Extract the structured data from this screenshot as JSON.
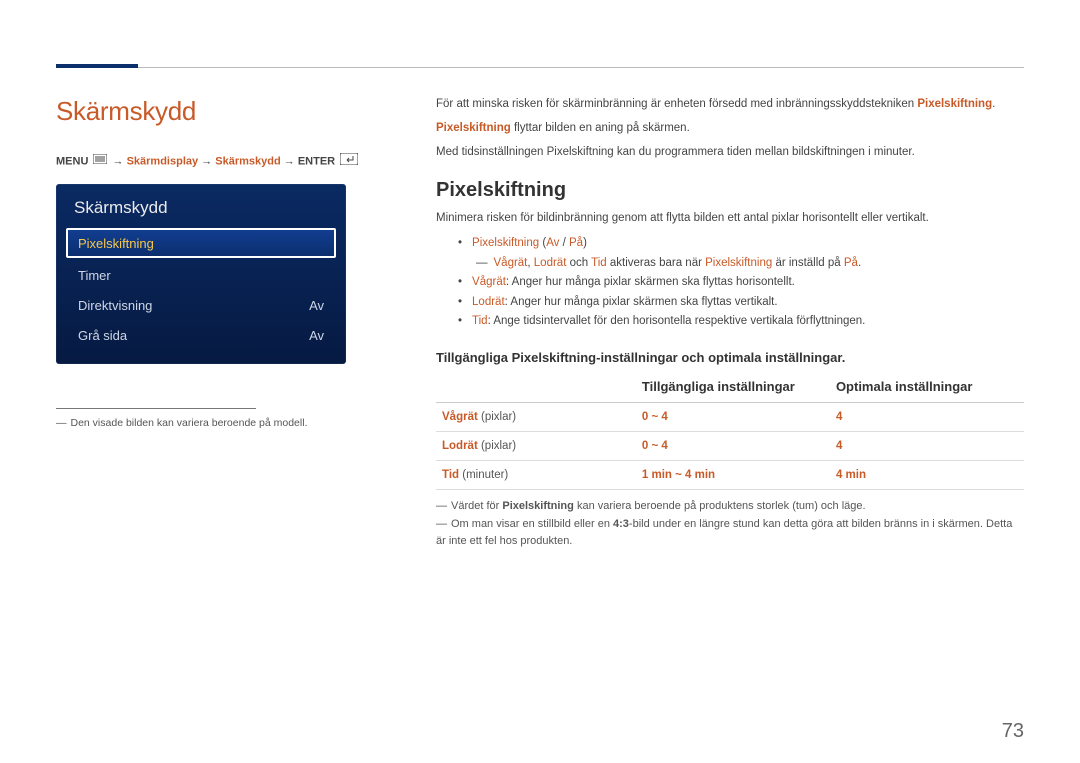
{
  "page_number": "73",
  "left": {
    "title": "Skärmskydd",
    "breadcrumb": {
      "menu_label": "MENU",
      "arrow": " → ",
      "seg1": "Skärmdisplay",
      "seg2": "Skärmskydd",
      "enter_label": "ENTER"
    },
    "panel": {
      "title": "Skärmskydd",
      "items": [
        {
          "label": "Pixelskiftning",
          "value": "",
          "selected": true
        },
        {
          "label": "Timer",
          "value": "",
          "selected": false
        },
        {
          "label": "Direktvisning",
          "value": "Av",
          "selected": false
        },
        {
          "label": "Grå sida",
          "value": "Av",
          "selected": false
        }
      ]
    },
    "disclaimer": "Den visade bilden kan variera beroende på modell."
  },
  "right": {
    "intro_parts": {
      "p1a": "För att minska risken för skärminbränning är enheten försedd med inbränningsskyddstekniken ",
      "p1b": "Pixelskiftning",
      "p1c": ".",
      "p2a": "Pixelskiftning",
      "p2b": " flyttar bilden en aning på skärmen.",
      "p3": "Med tidsinställningen Pixelskiftning kan du programmera tiden mellan bildskiftningen i minuter."
    },
    "section_title": "Pixelskiftning",
    "section_desc": "Minimera risken för bildinbränning genom att flytta bilden ett antal pixlar horisontellt eller vertikalt.",
    "bullets": {
      "b1_a": "Pixelskiftning",
      "b1_b": " (",
      "b1_c": "Av",
      "b1_d": " / ",
      "b1_e": "På",
      "b1_f": ")",
      "sub_a": "Vågrät",
      "sub_sep": ", ",
      "sub_b": "Lodrät",
      "sub_and": " och ",
      "sub_c": "Tid",
      "sub_mid": " aktiveras bara när ",
      "sub_d": "Pixelskiftning",
      "sub_e": " är inställd på ",
      "sub_f": "På",
      "sub_g": ".",
      "b2_a": "Vågrät",
      "b2_b": ": Anger hur många pixlar skärmen ska flyttas horisontellt.",
      "b3_a": "Lodrät",
      "b3_b": ": Anger hur många pixlar skärmen ska flyttas vertikalt.",
      "b4_a": "Tid",
      "b4_b": ": Ange tidsintervallet för den horisontella respektive vertikala förflyttningen."
    },
    "h3": "Tillgängliga Pixelskiftning-inställningar och optimala inställningar.",
    "table": {
      "col1": "",
      "col2": "Tillgängliga inställningar",
      "col3": "Optimala inställningar",
      "rows": [
        {
          "name": "Vågrät",
          "unit": " (pixlar)",
          "avail": "0 ~ 4",
          "opt": "4"
        },
        {
          "name": "Lodrät",
          "unit": " (pixlar)",
          "avail": "0 ~ 4",
          "opt": "4"
        },
        {
          "name": "Tid",
          "unit": " (minuter)",
          "avail": "1 min ~ 4 min",
          "opt": "4 min"
        }
      ]
    },
    "notes": {
      "n1a": "Värdet för ",
      "n1b": "Pixelskiftning",
      "n1c": " kan variera beroende på produktens storlek (tum) och läge.",
      "n2a": "Om man visar en stillbild eller en ",
      "n2b": "4:3",
      "n2c": "-bild under en längre stund kan detta göra att bilden bränns in i skärmen. Detta är inte ett fel hos produkten."
    }
  },
  "chart_data": {
    "type": "table",
    "title": "Tillgängliga Pixelskiftning-inställningar och optimala inställningar.",
    "columns": [
      "",
      "Tillgängliga inställningar",
      "Optimala inställningar"
    ],
    "rows": [
      [
        "Vågrät (pixlar)",
        "0 ~ 4",
        "4"
      ],
      [
        "Lodrät (pixlar)",
        "0 ~ 4",
        "4"
      ],
      [
        "Tid (minuter)",
        "1 min ~ 4 min",
        "4 min"
      ]
    ]
  }
}
